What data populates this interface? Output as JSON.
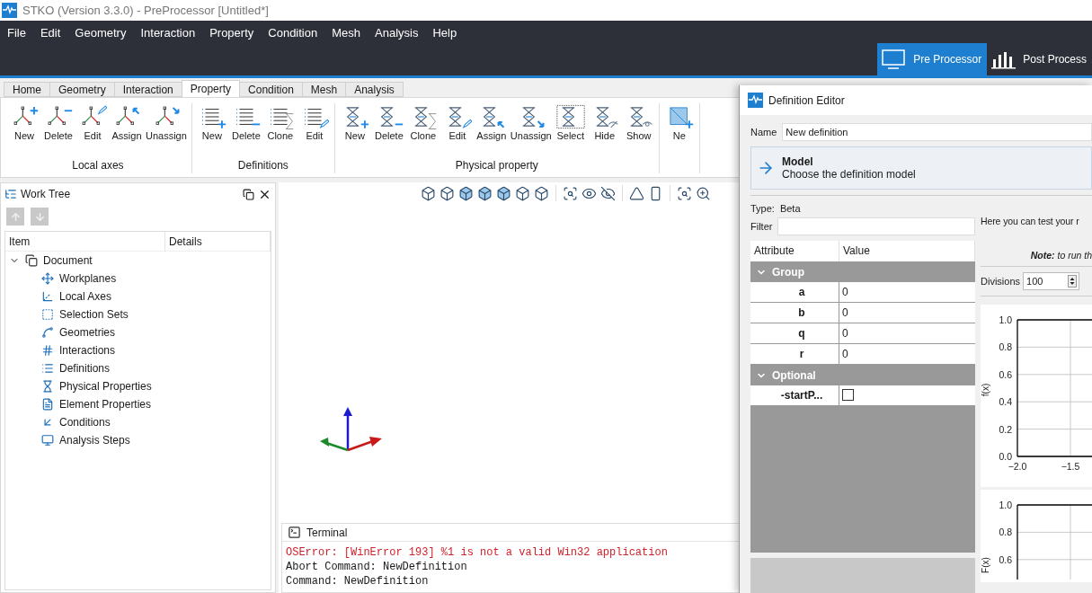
{
  "window": {
    "title": "STKO (Version 3.3.0) - PreProcessor [Untitled*]"
  },
  "menu": [
    "File",
    "Edit",
    "Geometry",
    "Interaction",
    "Property",
    "Condition",
    "Mesh",
    "Analysis",
    "Help"
  ],
  "modes": [
    {
      "label": "Pre Processor",
      "selected": true
    },
    {
      "label": "Post Process",
      "selected": false
    }
  ],
  "tabs": [
    {
      "label": "Home",
      "selected": false
    },
    {
      "label": "Geometry",
      "selected": false
    },
    {
      "label": "Interaction",
      "selected": false
    },
    {
      "label": "Property",
      "selected": true
    },
    {
      "label": "Condition",
      "selected": false
    },
    {
      "label": "Mesh",
      "selected": false
    },
    {
      "label": "Analysis",
      "selected": false
    }
  ],
  "ribbon": {
    "groups": [
      {
        "kind": "axes",
        "label": "Local axes",
        "buttons": [
          {
            "label": "New",
            "kind": "new"
          },
          {
            "label": "Delete",
            "kind": "delete"
          },
          {
            "label": "Edit",
            "kind": "edit"
          },
          {
            "label": "Assign",
            "kind": "assign"
          },
          {
            "label": "Unassign",
            "kind": "unassign"
          }
        ]
      },
      {
        "kind": "definitions",
        "label": "Definitions",
        "buttons": [
          {
            "label": "New",
            "kind": "new"
          },
          {
            "label": "Delete",
            "kind": "delete"
          },
          {
            "label": "Clone",
            "kind": "clone"
          },
          {
            "label": "Edit",
            "kind": "edit"
          }
        ]
      },
      {
        "kind": "physical",
        "label": "Physical property",
        "buttons": [
          {
            "label": "New",
            "kind": "new"
          },
          {
            "label": "Delete",
            "kind": "delete"
          },
          {
            "label": "Clone",
            "kind": "clone"
          },
          {
            "label": "Edit",
            "kind": "edit"
          },
          {
            "label": "Assign",
            "kind": "assign"
          },
          {
            "label": "Unassign",
            "kind": "unassign"
          },
          {
            "label": "Select",
            "kind": "select"
          },
          {
            "label": "Hide",
            "kind": "hide"
          },
          {
            "label": "Show",
            "kind": "show"
          }
        ]
      },
      {
        "kind": "element",
        "buttons": [
          {
            "label": "Ne",
            "kind": "new"
          }
        ]
      }
    ]
  },
  "work_tree": {
    "title": "Work Tree",
    "columns": [
      "Item",
      "Details"
    ],
    "tree": [
      {
        "label": "Document",
        "expanded": true,
        "children": [
          {
            "label": "Workplanes"
          },
          {
            "label": "Local Axes"
          },
          {
            "label": "Selection Sets"
          },
          {
            "label": "Geometries"
          },
          {
            "label": "Interactions"
          },
          {
            "label": "Definitions"
          },
          {
            "label": "Physical Properties"
          },
          {
            "label": "Element Properties"
          },
          {
            "label": "Conditions"
          },
          {
            "label": "Analysis Steps"
          }
        ]
      }
    ]
  },
  "terminal": {
    "title": "Terminal",
    "lines": [
      {
        "kind": "error",
        "text": "OSError: [WinError 193] %1 is not a valid Win32 application"
      },
      {
        "kind": "normal",
        "text": "Abort Command: NewDefinition"
      },
      {
        "kind": "normal",
        "text": "Command: NewDefinition"
      }
    ]
  },
  "dialog": {
    "title": "Definition Editor",
    "name": {
      "label": "Name",
      "value": "New definition"
    },
    "model": {
      "title": "Model",
      "subtitle": "Choose the definition model"
    },
    "type": {
      "label": "Type:",
      "value": "Beta"
    },
    "filter": {
      "label": "Filter"
    },
    "attributes": {
      "columns": [
        "Attribute",
        "Value"
      ],
      "groups": [
        {
          "label": "Group",
          "expanded": true,
          "rows": [
            {
              "name": "a",
              "kind": "text",
              "value": "0"
            },
            {
              "name": "b",
              "kind": "text",
              "value": "0"
            },
            {
              "name": "q",
              "kind": "text",
              "value": "0"
            },
            {
              "name": "r",
              "kind": "text",
              "value": "0"
            }
          ]
        },
        {
          "label": "Optional",
          "expanded": true,
          "rows": [
            {
              "name": "-startP...",
              "kind": "checkbox",
              "checked": false
            }
          ]
        }
      ]
    },
    "test_text": "Here you can test your r",
    "note": "**Note:** to run th",
    "divisions": {
      "label": "Divisions",
      "value": "100"
    },
    "plots": [
      {
        "ylabel": "f(x)",
        "y_tick_labels": [
          "1.0",
          "0.8",
          "0.6",
          "0.4",
          "0.2",
          "0.0"
        ],
        "x_tick_labels": [
          "−2.0",
          "−1.5"
        ]
      },
      {
        "ylabel": "F(x)",
        "y_tick_labels": [
          "1.0",
          "0.8",
          "0.6"
        ]
      }
    ]
  }
}
